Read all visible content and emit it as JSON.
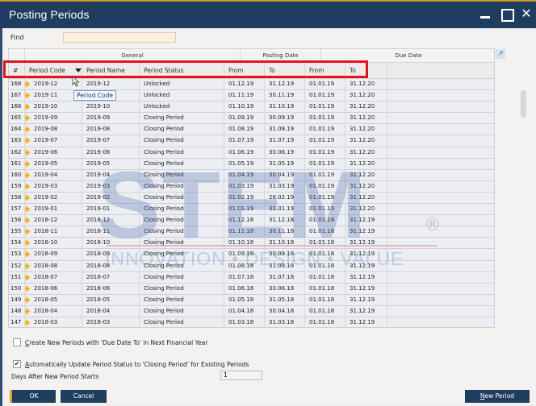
{
  "window": {
    "title": "Posting Periods"
  },
  "find": {
    "label": "Find",
    "value": ""
  },
  "grid": {
    "groups": {
      "general": "General",
      "posting": "Posting Date",
      "due": "Due Date"
    },
    "columns": [
      "#",
      "Period Code",
      "Period Name",
      "Period Status",
      "From",
      "To",
      "From",
      "To"
    ],
    "tooltip": "Period Code",
    "rows": [
      {
        "num": "168",
        "code": "2019-12",
        "name": "2019-12",
        "status": "Unlocked",
        "pfrom": "01.12.19",
        "pto": "31.12.19",
        "dfrom": "01.01.19",
        "dto": "31.12.20"
      },
      {
        "num": "167",
        "code": "2019-11",
        "name": "2019-11",
        "status": "Unlocked",
        "pfrom": "01.11.19",
        "pto": "30.11.19",
        "dfrom": "01.01.19",
        "dto": "31.12.20"
      },
      {
        "num": "166",
        "code": "2019-10",
        "name": "2019-10",
        "status": "Unlocked",
        "pfrom": "01.10.19",
        "pto": "31.10.19",
        "dfrom": "01.01.19",
        "dto": "31.12.20"
      },
      {
        "num": "165",
        "code": "2019-09",
        "name": "2019-09",
        "status": "Closing Period",
        "pfrom": "01.09.19",
        "pto": "30.09.19",
        "dfrom": "01.01.19",
        "dto": "31.12.20"
      },
      {
        "num": "164",
        "code": "2019-08",
        "name": "2019-08",
        "status": "Closing Period",
        "pfrom": "01.08.19",
        "pto": "31.08.19",
        "dfrom": "01.01.19",
        "dto": "31.12.20"
      },
      {
        "num": "163",
        "code": "2019-07",
        "name": "2019-07",
        "status": "Closing Period",
        "pfrom": "01.07.19",
        "pto": "31.07.19",
        "dfrom": "01.01.19",
        "dto": "31.12.20"
      },
      {
        "num": "162",
        "code": "2019-06",
        "name": "2019-06",
        "status": "Closing Period",
        "pfrom": "01.06.19",
        "pto": "30.06.19",
        "dfrom": "01.01.19",
        "dto": "31.12.20"
      },
      {
        "num": "161",
        "code": "2019-05",
        "name": "2019-05",
        "status": "Closing Period",
        "pfrom": "01.05.19",
        "pto": "31.05.19",
        "dfrom": "01.01.19",
        "dto": "31.12.20"
      },
      {
        "num": "160",
        "code": "2019-04",
        "name": "2019-04",
        "status": "Closing Period",
        "pfrom": "01.04.19",
        "pto": "30.04.19",
        "dfrom": "01.01.19",
        "dto": "31.12.20"
      },
      {
        "num": "159",
        "code": "2019-03",
        "name": "2019-03",
        "status": "Closing Period",
        "pfrom": "01.03.19",
        "pto": "31.03.19",
        "dfrom": "01.01.19",
        "dto": "31.12.20"
      },
      {
        "num": "158",
        "code": "2019-02",
        "name": "2019-02",
        "status": "Closing Period",
        "pfrom": "01.02.19",
        "pto": "28.02.19",
        "dfrom": "01.01.19",
        "dto": "31.12.20"
      },
      {
        "num": "157",
        "code": "2019-01",
        "name": "2019-01",
        "status": "Closing Period",
        "pfrom": "01.01.19",
        "pto": "31.01.19",
        "dfrom": "01.01.19",
        "dto": "31.12.20"
      },
      {
        "num": "156",
        "code": "2018-12",
        "name": "2018-12",
        "status": "Closing Period",
        "pfrom": "01.12.18",
        "pto": "31.12.18",
        "dfrom": "01.01.18",
        "dto": "31.12.19"
      },
      {
        "num": "155",
        "code": "2018-11",
        "name": "2018-11",
        "status": "Closing Period",
        "pfrom": "01.11.18",
        "pto": "30.11.18",
        "dfrom": "01.01.18",
        "dto": "31.12.19"
      },
      {
        "num": "154",
        "code": "2018-10",
        "name": "2018-10",
        "status": "Closing Period",
        "pfrom": "01.10.18",
        "pto": "31.10.18",
        "dfrom": "01.01.18",
        "dto": "31.12.19"
      },
      {
        "num": "153",
        "code": "2018-09",
        "name": "2018-09",
        "status": "Closing Period",
        "pfrom": "01.09.18",
        "pto": "30.09.18",
        "dfrom": "01.01.18",
        "dto": "31.12.19"
      },
      {
        "num": "152",
        "code": "2018-08",
        "name": "2018-08",
        "status": "Closing Period",
        "pfrom": "01.08.18",
        "pto": "31.08.18",
        "dfrom": "01.01.18",
        "dto": "31.12.19"
      },
      {
        "num": "151",
        "code": "2018-07",
        "name": "2018-07",
        "status": "Closing Period",
        "pfrom": "01.07.18",
        "pto": "31.07.18",
        "dfrom": "01.01.18",
        "dto": "31.12.19"
      },
      {
        "num": "150",
        "code": "2018-06",
        "name": "2018-06",
        "status": "Closing Period",
        "pfrom": "01.06.18",
        "pto": "30.06.18",
        "dfrom": "01.01.18",
        "dto": "31.12.19"
      },
      {
        "num": "149",
        "code": "2018-05",
        "name": "2018-05",
        "status": "Closing Period",
        "pfrom": "01.05.18",
        "pto": "31.05.18",
        "dfrom": "01.01.18",
        "dto": "31.12.19"
      },
      {
        "num": "148",
        "code": "2018-04",
        "name": "2018-04",
        "status": "Closing Period",
        "pfrom": "01.04.18",
        "pto": "30.04.18",
        "dfrom": "01.01.18",
        "dto": "31.12.19"
      },
      {
        "num": "147",
        "code": "2018-03",
        "name": "2018-03",
        "status": "Closing Period",
        "pfrom": "01.03.18",
        "pto": "31.03.18",
        "dfrom": "01.01.18",
        "dto": "31.12.19"
      }
    ]
  },
  "watermark": {
    "main": "STEM",
    "registered": "®",
    "sub": "INNOVATION • DESIGN • VALUE"
  },
  "options": {
    "create_new_label_u": "C",
    "create_new_label": "reate New Periods with 'Due Date To' in Next Financial Year",
    "create_new_checked": false,
    "auto_update_label_u": "A",
    "auto_update_label": "utomatically Update Period Status to 'Closing Period' for Existing Periods",
    "auto_update_checked": true,
    "days_label": "Days After New Period Starts",
    "days_value": "1"
  },
  "buttons": {
    "ok": "OK",
    "cancel": "Cancel",
    "new_period_u": "N",
    "new_period": "ew Period"
  },
  "colors": {
    "titlebar": "#1f3d5e",
    "accent": "#e2a22d",
    "highlight": "#e4141e",
    "arrow": "#f2b51c"
  }
}
